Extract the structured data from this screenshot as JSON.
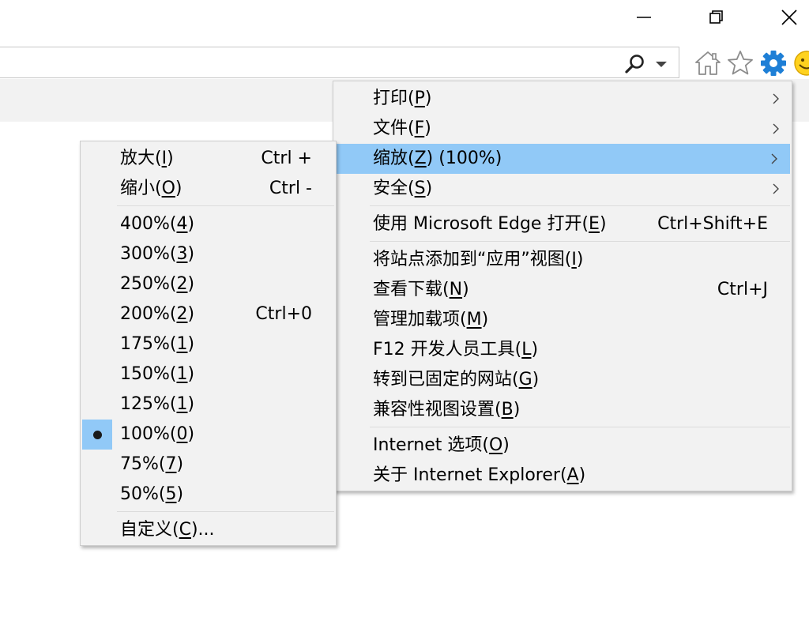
{
  "window": {
    "minimize_icon": "minimize-icon",
    "restore_icon": "restore-icon",
    "close_icon": "close-icon"
  },
  "address_bar": {
    "value": "",
    "search_icon": "search-icon",
    "dropdown_icon": "chevron-down-icon"
  },
  "toolbar": {
    "icons": [
      "home-icon",
      "favorites-star-icon",
      "tools-gear-icon",
      "smiley-feedback-icon"
    ],
    "accent_color": "#1e7fd6"
  },
  "tools_menu": {
    "highlight_color": "#91c9f7",
    "items": [
      {
        "pre": "打印(",
        "key": "P",
        "post": ")",
        "submenu": true
      },
      {
        "pre": "文件(",
        "key": "F",
        "post": ")",
        "submenu": true
      },
      {
        "pre": "缩放(",
        "key": "Z",
        "post": ") (100%)",
        "submenu": true,
        "highlighted": true
      },
      {
        "pre": "安全(",
        "key": "S",
        "post": ")",
        "submenu": true
      },
      {
        "pre": "使用 Microsoft Edge 打开(",
        "key": "E",
        "post": ")",
        "shortcut": "Ctrl+Shift+E"
      },
      {
        "pre": "将站点添加到“应用”视图(",
        "key": "I",
        "post": ")"
      },
      {
        "pre": "查看下载(",
        "key": "N",
        "post": ")",
        "shortcut": "Ctrl+J"
      },
      {
        "pre": "管理加载项(",
        "key": "M",
        "post": ")"
      },
      {
        "pre": "F12 开发人员工具(",
        "key": "L",
        "post": ")"
      },
      {
        "pre": "转到已固定的网站(",
        "key": "G",
        "post": ")"
      },
      {
        "pre": "兼容性视图设置(",
        "key": "B",
        "post": ")"
      },
      {
        "pre": "Internet 选项(",
        "key": "O",
        "post": ")"
      },
      {
        "pre": "关于 Internet Explorer(",
        "key": "A",
        "post": ")"
      }
    ]
  },
  "zoom_menu": {
    "items": [
      {
        "pre": "放大(",
        "key": "I",
        "post": ")",
        "shortcut": "Ctrl +"
      },
      {
        "pre": "缩小(",
        "key": "O",
        "post": ")",
        "shortcut": "Ctrl -"
      },
      {
        "pre": "400%(",
        "key": "4",
        "post": ")"
      },
      {
        "pre": "300%(",
        "key": "3",
        "post": ")"
      },
      {
        "pre": "250%(",
        "key": "2",
        "post": ")"
      },
      {
        "pre": "200%(",
        "key": "2",
        "post": ")",
        "shortcut": "Ctrl+0"
      },
      {
        "pre": "175%(",
        "key": "1",
        "post": ")"
      },
      {
        "pre": "150%(",
        "key": "1",
        "post": ")"
      },
      {
        "pre": "125%(",
        "key": "1",
        "post": ")"
      },
      {
        "pre": "100%(",
        "key": "0",
        "post": ")",
        "selected": true
      },
      {
        "pre": "75%(",
        "key": "7",
        "post": ")"
      },
      {
        "pre": "50%(",
        "key": "5",
        "post": ")"
      },
      {
        "pre": "自定义(",
        "key": "C",
        "post": ")..."
      }
    ]
  }
}
